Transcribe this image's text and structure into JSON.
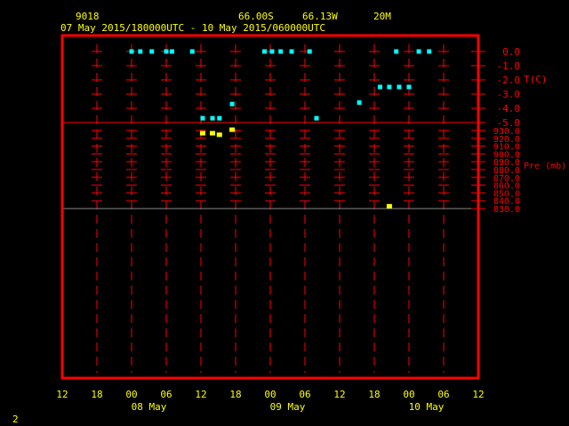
{
  "header": {
    "station": "9018",
    "lat": "66.00S",
    "lon": "66.13W",
    "elev": "20M",
    "period": "07 May 2015/180000UTC - 10 May 2015/060000UTC"
  },
  "footer": {
    "page": "2"
  },
  "chart_data": {
    "type": "scatter",
    "x_unit": "hours since 07 May 2015 12UTC",
    "xlim": [
      0,
      72
    ],
    "x_ticks": [
      "12",
      "18",
      "00",
      "06",
      "12",
      "18",
      "00",
      "06",
      "12",
      "18",
      "00",
      "06",
      "12"
    ],
    "date_labels": [
      {
        "label": "08 May",
        "hour": 15
      },
      {
        "label": "09 May",
        "hour": 39
      },
      {
        "label": "10 May",
        "hour": 63
      }
    ],
    "panels": [
      {
        "name": "temperature",
        "ylabel": "T(C)",
        "ylim": [
          -5,
          0
        ],
        "y_ticks": [
          "0.0",
          "-1.0",
          "-2.0",
          "-3.0",
          "-4.0",
          "-5.0"
        ],
        "color": "#00ffff",
        "points": [
          [
            12,
            0
          ],
          [
            13.5,
            0
          ],
          [
            15.5,
            0
          ],
          [
            18,
            0
          ],
          [
            19,
            0
          ],
          [
            22.5,
            0
          ],
          [
            35,
            0
          ],
          [
            36.3,
            0
          ],
          [
            37.8,
            0
          ],
          [
            39.7,
            0
          ],
          [
            42.8,
            0
          ],
          [
            57.8,
            0
          ],
          [
            61.7,
            0
          ],
          [
            63.5,
            0
          ],
          [
            24.3,
            -4.7
          ],
          [
            26,
            -4.7
          ],
          [
            27.2,
            -4.7
          ],
          [
            29.4,
            -3.7
          ],
          [
            44,
            -4.7
          ],
          [
            51.4,
            -3.6
          ],
          [
            55,
            -2.5
          ],
          [
            56.6,
            -2.5
          ],
          [
            58.3,
            -2.5
          ],
          [
            60,
            -2.5
          ]
        ]
      },
      {
        "name": "pressure",
        "ylabel": "Pre (mb)",
        "ylim": [
          830,
          930
        ],
        "y_ticks": [
          "930.0",
          "920.0",
          "910.0",
          "900.0",
          "890.0",
          "880.0",
          "870.0",
          "860.0",
          "850.0",
          "840.0",
          "830.0"
        ],
        "color": "#ffff00",
        "points": [
          [
            24.3,
            926.5
          ],
          [
            26,
            926.5
          ],
          [
            27.2,
            924.5
          ],
          [
            29.4,
            931
          ],
          [
            56.6,
            833
          ]
        ]
      }
    ]
  }
}
